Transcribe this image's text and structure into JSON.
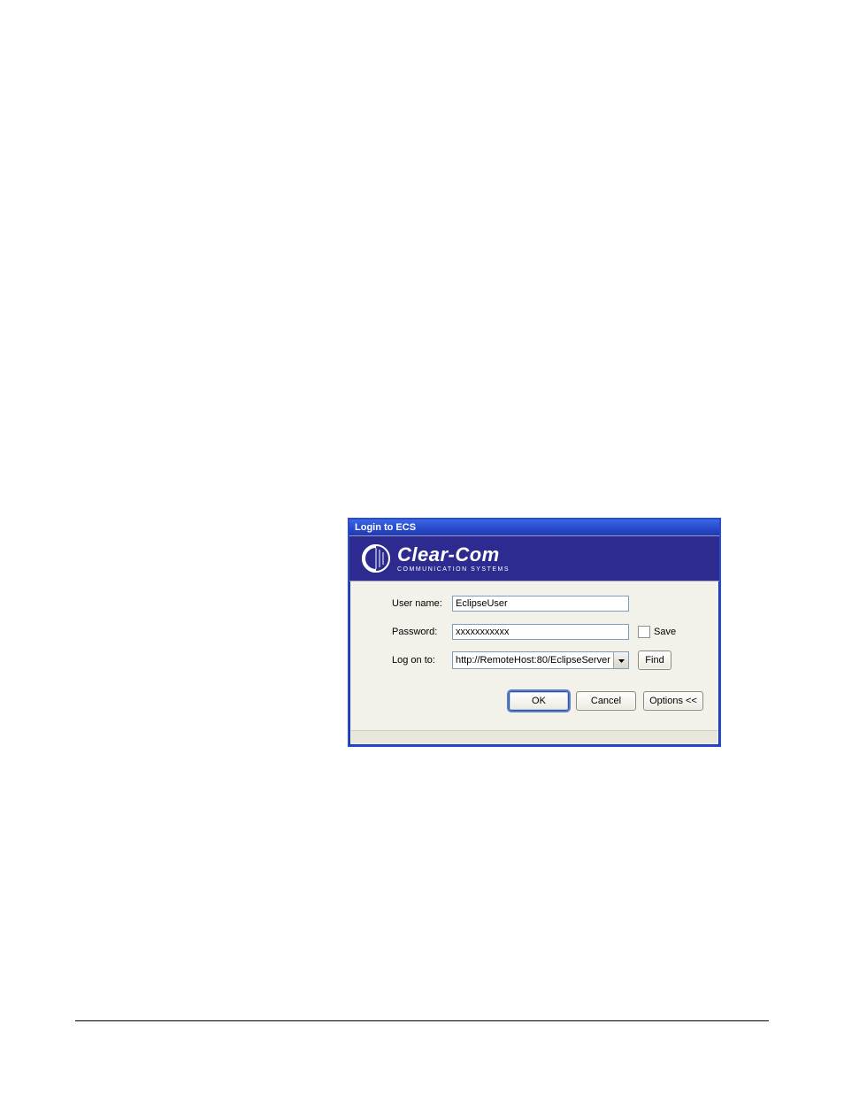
{
  "dialog": {
    "title": "Login to ECS",
    "brand": {
      "name": "Clear-Com",
      "tagline": "COMMUNICATION SYSTEMS"
    },
    "form": {
      "username_label": "User name:",
      "username_value": "EclipseUser",
      "password_label": "Password:",
      "password_value": "xxxxxxxxxxx",
      "save_label": "Save",
      "logon_label": "Log on to:",
      "logon_value": "http://RemoteHost:80/EclipseServer",
      "find_label": "Find"
    },
    "buttons": {
      "ok": "OK",
      "cancel": "Cancel",
      "options": "Options <<"
    }
  }
}
